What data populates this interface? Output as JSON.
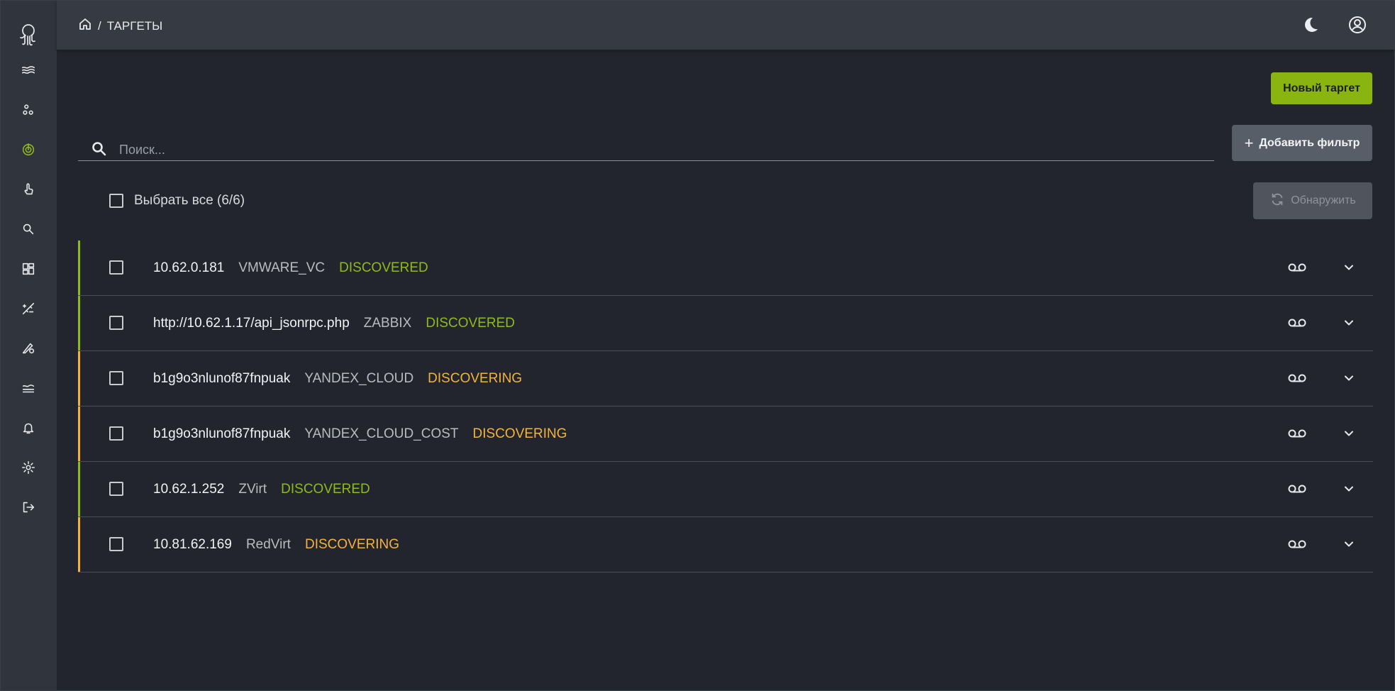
{
  "breadcrumb": {
    "current": "ТАРГЕТЫ",
    "separator": "/"
  },
  "sidebar": {
    "items": [
      {
        "name": "logo-icon"
      },
      {
        "name": "waves-icon"
      },
      {
        "name": "nodes-icon"
      },
      {
        "name": "target-icon",
        "active": true
      },
      {
        "name": "touch-icon"
      },
      {
        "name": "search-icon"
      },
      {
        "name": "dashboard-icon"
      },
      {
        "name": "chart-icon"
      },
      {
        "name": "settings-edit-icon"
      },
      {
        "name": "layers-icon"
      },
      {
        "name": "bell-icon"
      },
      {
        "name": "gear-icon"
      },
      {
        "name": "logout-icon"
      }
    ]
  },
  "toolbar": {
    "new_target": "Новый таргет",
    "add_filter": "Добавить фильтр",
    "add_filter_plus": "+",
    "discover": "Обнаружить"
  },
  "search": {
    "placeholder": "Поиск..."
  },
  "select_all": {
    "label": "Выбрать все (6/6)"
  },
  "colors": {
    "accent": "#8ab511",
    "discovered": "#8fba1c",
    "discovering": "#f3b33d"
  },
  "targets": [
    {
      "address": "10.62.0.181",
      "type": "VMWARE_VC",
      "status": "DISCOVERED",
      "state": "discovered"
    },
    {
      "address": "http://10.62.1.17/api_jsonrpc.php",
      "type": "ZABBIX",
      "status": "DISCOVERED",
      "state": "discovered"
    },
    {
      "address": "b1g9o3nlunof87fnpuak",
      "type": "YANDEX_CLOUD",
      "status": "DISCOVERING",
      "state": "discovering"
    },
    {
      "address": "b1g9o3nlunof87fnpuak",
      "type": "YANDEX_CLOUD_COST",
      "status": "DISCOVERING",
      "state": "discovering"
    },
    {
      "address": "10.62.1.252",
      "type": "ZVirt",
      "status": "DISCOVERED",
      "state": "discovered"
    },
    {
      "address": "10.81.62.169",
      "type": "RedVirt",
      "status": "DISCOVERING",
      "state": "discovering"
    }
  ]
}
